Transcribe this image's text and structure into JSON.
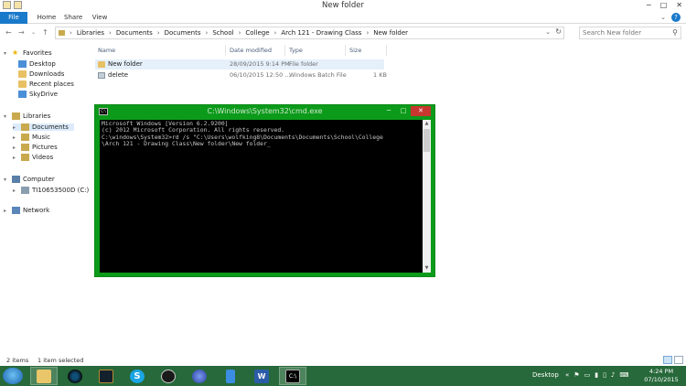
{
  "window": {
    "title": "New folder"
  },
  "ribbon": {
    "tabs": [
      "File",
      "Home",
      "Share",
      "View"
    ]
  },
  "address": {
    "crumbs": [
      "Libraries",
      "Documents",
      "Documents",
      "School",
      "College",
      "Arch 121 - Drawing Class",
      "New folder"
    ],
    "search_placeholder": "Search New folder"
  },
  "nav": {
    "favorites": "Favorites",
    "desktop": "Desktop",
    "downloads": "Downloads",
    "recent": "Recent places",
    "skydrive": "SkyDrive",
    "libraries": "Libraries",
    "documents": "Documents",
    "music": "Music",
    "pictures": "Pictures",
    "videos": "Videos",
    "computer": "Computer",
    "drive": "TI10653500D (C:)",
    "network": "Network"
  },
  "filelist": {
    "headers": {
      "name": "Name",
      "date": "Date modified",
      "type": "Type",
      "size": "Size"
    },
    "rows": [
      {
        "name": "New folder",
        "date": "28/09/2015 9:14 PM",
        "type": "File folder",
        "size": ""
      },
      {
        "name": "delete",
        "date": "06/10/2015 12:50 ...",
        "type": "Windows Batch File",
        "size": "1 KB"
      }
    ]
  },
  "cmd": {
    "title": "C:\\Windows\\System32\\cmd.exe",
    "icon_label": "C:\\",
    "lines": [
      "Microsoft Windows [Version 6.2.9200]",
      "(c) 2012 Microsoft Corporation. All rights reserved.",
      "",
      "C:\\windows\\System32>rd /s \"C:\\Users\\wolfking8\\Documents\\Documents\\School\\College",
      "\\Arch 121 - Drawing Class\\New folder\\New folder_"
    ]
  },
  "status": {
    "items": "2 items",
    "selected": "1 item selected"
  },
  "taskbar": {
    "desktop": "Desktop",
    "time": "4:24 PM",
    "date": "07/10/2015"
  },
  "colors": {
    "accent": "#1979ca",
    "cmd_frame": "#0c9a1a",
    "taskbar": "#27693a"
  }
}
